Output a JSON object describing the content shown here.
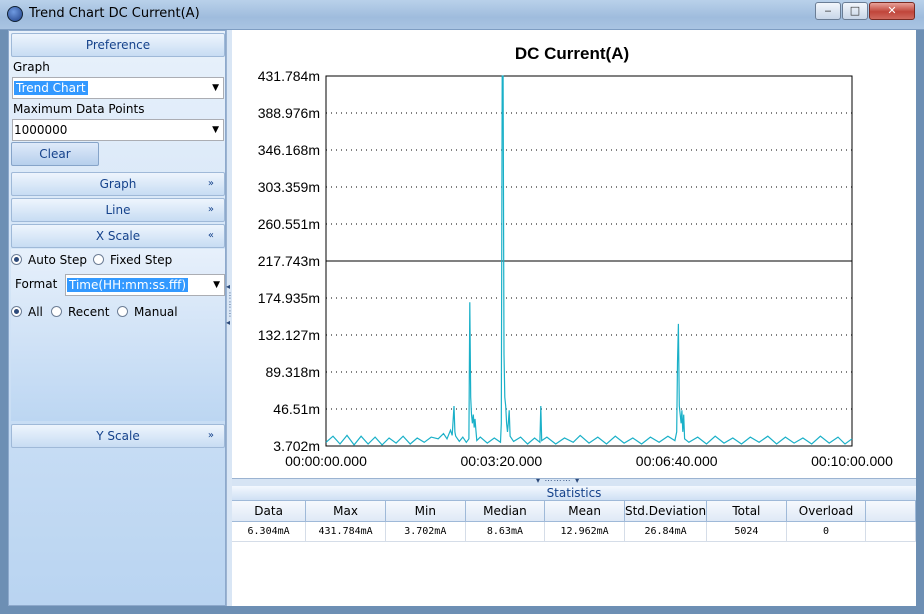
{
  "window": {
    "title": "Trend Chart DC Current(A)",
    "controls": {
      "minimize": "‒",
      "maximize": "□",
      "close": "✕"
    }
  },
  "left_panel": {
    "preference_header": "Preference",
    "graph_label": "Graph",
    "graph_value": "Trend Chart",
    "max_points_label": "Maximum Data Points",
    "max_points_value": "1000000",
    "clear_button": "Clear",
    "sections": {
      "graph": "Graph",
      "line": "Line",
      "x_scale": "X Scale",
      "y_scale": "Y Scale"
    },
    "x_scale": {
      "step_options": [
        {
          "label": "Auto Step",
          "selected": true
        },
        {
          "label": "Fixed Step",
          "selected": false
        }
      ],
      "format_label": "Format",
      "format_value": "Time(HH:mm:ss.fff)",
      "range_options": [
        {
          "label": "All",
          "selected": true
        },
        {
          "label": "Recent",
          "selected": false
        },
        {
          "label": "Manual",
          "selected": false
        }
      ]
    },
    "icons": {
      "collapsed": "chevron-double-down-icon",
      "expanded": "chevron-double-up-icon",
      "dropdown": "dropdown-arrow-icon"
    }
  },
  "chart_data": {
    "type": "line",
    "title": "DC Current(A)",
    "xlabel": "",
    "ylabel": "",
    "x_ticks": [
      "00:00:00.000",
      "00:03:20.000",
      "00:06:40.000",
      "00:10:00.000"
    ],
    "y_ticks": [
      "431.784m",
      "388.976m",
      "346.168m",
      "303.359m",
      "260.551m",
      "217.743m",
      "174.935m",
      "132.127m",
      "89.318m",
      "46.51m",
      "3.702m"
    ],
    "ylim": [
      0.003702,
      0.431784
    ],
    "xlim_seconds": [
      0,
      600
    ],
    "grid": "horizontal dotted",
    "line_color": "#1ab0c8",
    "series": [
      {
        "values": [
          [
            0,
            0.008
          ],
          [
            8,
            0.015
          ],
          [
            16,
            0.006
          ],
          [
            24,
            0.016
          ],
          [
            32,
            0.005
          ],
          [
            40,
            0.015
          ],
          [
            48,
            0.006
          ],
          [
            56,
            0.014
          ],
          [
            64,
            0.005
          ],
          [
            72,
            0.013
          ],
          [
            80,
            0.007
          ],
          [
            88,
            0.015
          ],
          [
            96,
            0.006
          ],
          [
            104,
            0.013
          ],
          [
            112,
            0.008
          ],
          [
            120,
            0.014
          ],
          [
            128,
            0.012
          ],
          [
            134,
            0.018
          ],
          [
            138,
            0.012
          ],
          [
            142,
            0.022
          ],
          [
            144,
            0.016
          ],
          [
            146,
            0.05
          ],
          [
            147,
            0.02
          ],
          [
            148,
            0.015
          ],
          [
            152,
            0.009
          ],
          [
            156,
            0.014
          ],
          [
            160,
            0.008
          ],
          [
            163,
            0.012
          ],
          [
            164,
            0.17
          ],
          [
            165,
            0.06
          ],
          [
            166,
            0.04
          ],
          [
            167,
            0.03
          ],
          [
            168,
            0.04
          ],
          [
            169,
            0.025
          ],
          [
            170,
            0.035
          ],
          [
            171,
            0.022
          ],
          [
            172,
            0.01
          ],
          [
            176,
            0.014
          ],
          [
            184,
            0.007
          ],
          [
            192,
            0.013
          ],
          [
            199,
            0.008
          ],
          [
            200,
            0.03
          ],
          [
            201,
            0.431784
          ],
          [
            202,
            0.431784
          ],
          [
            203,
            0.11
          ],
          [
            204,
            0.06
          ],
          [
            205,
            0.05
          ],
          [
            206,
            0.03
          ],
          [
            207,
            0.02
          ],
          [
            208,
            0.03
          ],
          [
            209,
            0.045
          ],
          [
            210,
            0.015
          ],
          [
            214,
            0.009
          ],
          [
            222,
            0.014
          ],
          [
            230,
            0.006
          ],
          [
            238,
            0.013
          ],
          [
            244,
            0.008
          ],
          [
            245,
            0.05
          ],
          [
            246,
            0.01
          ],
          [
            252,
            0.014
          ],
          [
            262,
            0.006
          ],
          [
            272,
            0.013
          ],
          [
            282,
            0.008
          ],
          [
            290,
            0.016
          ],
          [
            300,
            0.007
          ],
          [
            310,
            0.014
          ],
          [
            320,
            0.006
          ],
          [
            330,
            0.015
          ],
          [
            340,
            0.007
          ],
          [
            350,
            0.013
          ],
          [
            360,
            0.006
          ],
          [
            370,
            0.014
          ],
          [
            380,
            0.008
          ],
          [
            390,
            0.015
          ],
          [
            398,
            0.01
          ],
          [
            400,
            0.02
          ],
          [
            401,
            0.1
          ],
          [
            402,
            0.145
          ],
          [
            403,
            0.05
          ],
          [
            404,
            0.04
          ],
          [
            405,
            0.03
          ],
          [
            406,
            0.045
          ],
          [
            407,
            0.02
          ],
          [
            408,
            0.04
          ],
          [
            409,
            0.012
          ],
          [
            414,
            0.008
          ],
          [
            424,
            0.014
          ],
          [
            434,
            0.006
          ],
          [
            444,
            0.015
          ],
          [
            454,
            0.007
          ],
          [
            464,
            0.013
          ],
          [
            474,
            0.006
          ],
          [
            484,
            0.014
          ],
          [
            494,
            0.008
          ],
          [
            504,
            0.015
          ],
          [
            514,
            0.006
          ],
          [
            524,
            0.014
          ],
          [
            534,
            0.007
          ],
          [
            544,
            0.013
          ],
          [
            554,
            0.006
          ],
          [
            564,
            0.015
          ],
          [
            574,
            0.007
          ],
          [
            584,
            0.014
          ],
          [
            592,
            0.006
          ],
          [
            600,
            0.012
          ]
        ]
      }
    ],
    "statistics": {
      "columns": [
        "Data",
        "Max",
        "Min",
        "Median",
        "Mean",
        "Std.Deviation",
        "Total",
        "Overload"
      ],
      "rows": [
        [
          "6.304mA",
          "431.784mA",
          "3.702mA",
          "8.63mA",
          "12.962mA",
          "26.84mA",
          "5024",
          "0"
        ]
      ]
    }
  },
  "stats_header": "Statistics"
}
